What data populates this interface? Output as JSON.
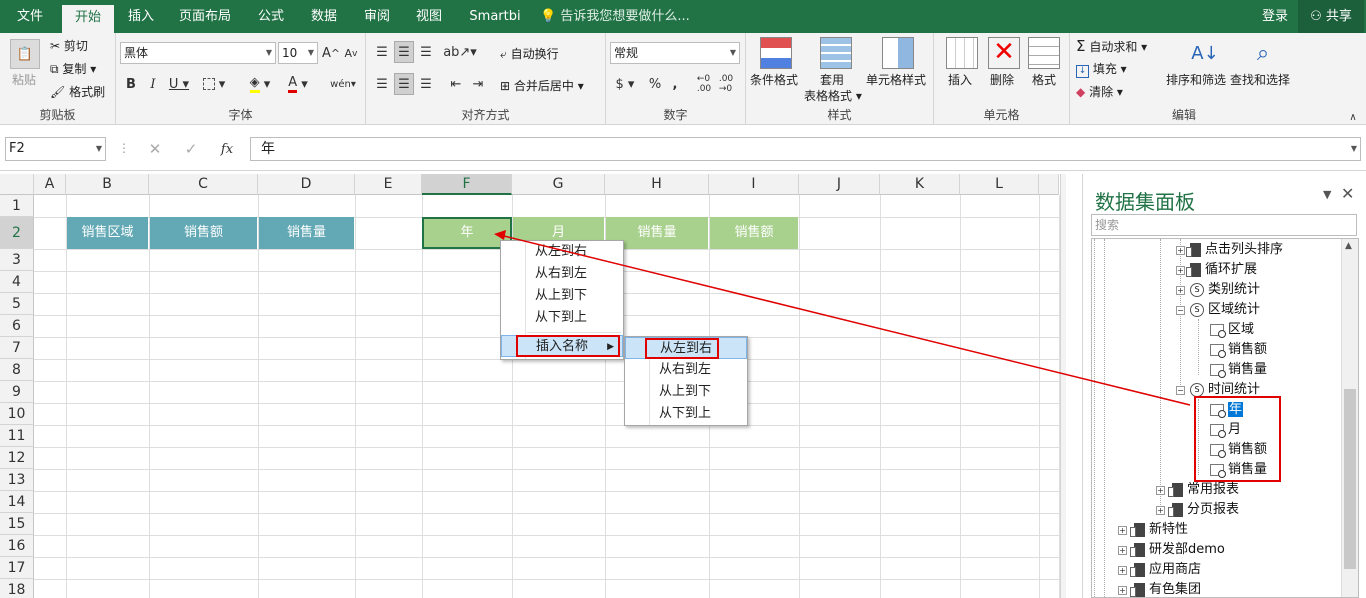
{
  "tabs": [
    "文件",
    "开始",
    "插入",
    "页面布局",
    "公式",
    "数据",
    "审阅",
    "视图",
    "Smartbi"
  ],
  "tell_me": "告诉我您想要做什么...",
  "login": "登录",
  "share": "共享",
  "ribbon": {
    "clipboard": {
      "label": "剪贴板",
      "paste": "粘贴",
      "cut": "剪切",
      "copy": "复制",
      "format_painter": "格式刷"
    },
    "font": {
      "label": "字体",
      "font_name": "黑体",
      "font_size": "10",
      "bold": "B",
      "italic": "I",
      "underline": "U",
      "grow": "A",
      "shrink": "A",
      "wen": "wén"
    },
    "align": {
      "label": "对齐方式",
      "wrap": "自动换行",
      "merge": "合并后居中"
    },
    "number": {
      "label": "数字",
      "format": "常规",
      "currency": "$",
      "percent": "%",
      "comma": ","
    },
    "styles": {
      "label": "样式",
      "cond": "条件格式",
      "table1": "套用",
      "table2": "表格格式",
      "cell": "单元格样式"
    },
    "cells": {
      "label": "单元格",
      "insert": "插入",
      "delete": "删除",
      "format": "格式"
    },
    "edit": {
      "label": "编辑",
      "autosum": "自动求和",
      "fill": "填充",
      "clear": "清除",
      "sort": "排序和筛选",
      "find": "查找和选择"
    }
  },
  "formula": {
    "namebox": "F2",
    "fx": "fx",
    "value": "年"
  },
  "columns": [
    "A",
    "B",
    "C",
    "D",
    "E",
    "F",
    "G",
    "H",
    "I",
    "J",
    "K",
    "L"
  ],
  "rows": [
    "1",
    "2",
    "3",
    "4",
    "5",
    "6",
    "7",
    "8",
    "9",
    "10",
    "11",
    "12",
    "13",
    "14",
    "15",
    "16",
    "17",
    "18"
  ],
  "headers_left": [
    "销售区域",
    "销售额",
    "销售量"
  ],
  "headers_right": [
    "年",
    "月",
    "销售量",
    "销售额"
  ],
  "context_menu": [
    "从左到右",
    "从右到左",
    "从上到下",
    "从下到上",
    "插入名称"
  ],
  "submenu": [
    "从左到右",
    "从右到左",
    "从上到下",
    "从下到上"
  ],
  "panel": {
    "title": "数据集面板",
    "search_placeholder": "搜索",
    "tree": [
      {
        "label": "点击列头排序",
        "icon": "doc"
      },
      {
        "label": "循环扩展",
        "icon": "doc"
      },
      {
        "label": "类别统计",
        "icon": "query"
      },
      {
        "label": "区域统计",
        "icon": "query"
      },
      {
        "label": "区域",
        "icon": "field"
      },
      {
        "label": "销售额",
        "icon": "field"
      },
      {
        "label": "销售量",
        "icon": "field"
      },
      {
        "label": "时间统计",
        "icon": "query"
      },
      {
        "label": "年",
        "icon": "field"
      },
      {
        "label": "月",
        "icon": "field"
      },
      {
        "label": "销售额",
        "icon": "field"
      },
      {
        "label": "销售量",
        "icon": "field"
      },
      {
        "label": "常用报表",
        "icon": "doc"
      },
      {
        "label": "分页报表",
        "icon": "doc"
      },
      {
        "label": "新特性",
        "icon": "doc"
      },
      {
        "label": "研发部demo",
        "icon": "doc"
      },
      {
        "label": "应用商店",
        "icon": "doc"
      },
      {
        "label": "有色集团",
        "icon": "doc"
      }
    ]
  },
  "colors": {
    "excel_green": "#217346",
    "teal_header": "#63a9b5",
    "green_header": "#a9d18e",
    "highlight_red": "#e00000"
  }
}
